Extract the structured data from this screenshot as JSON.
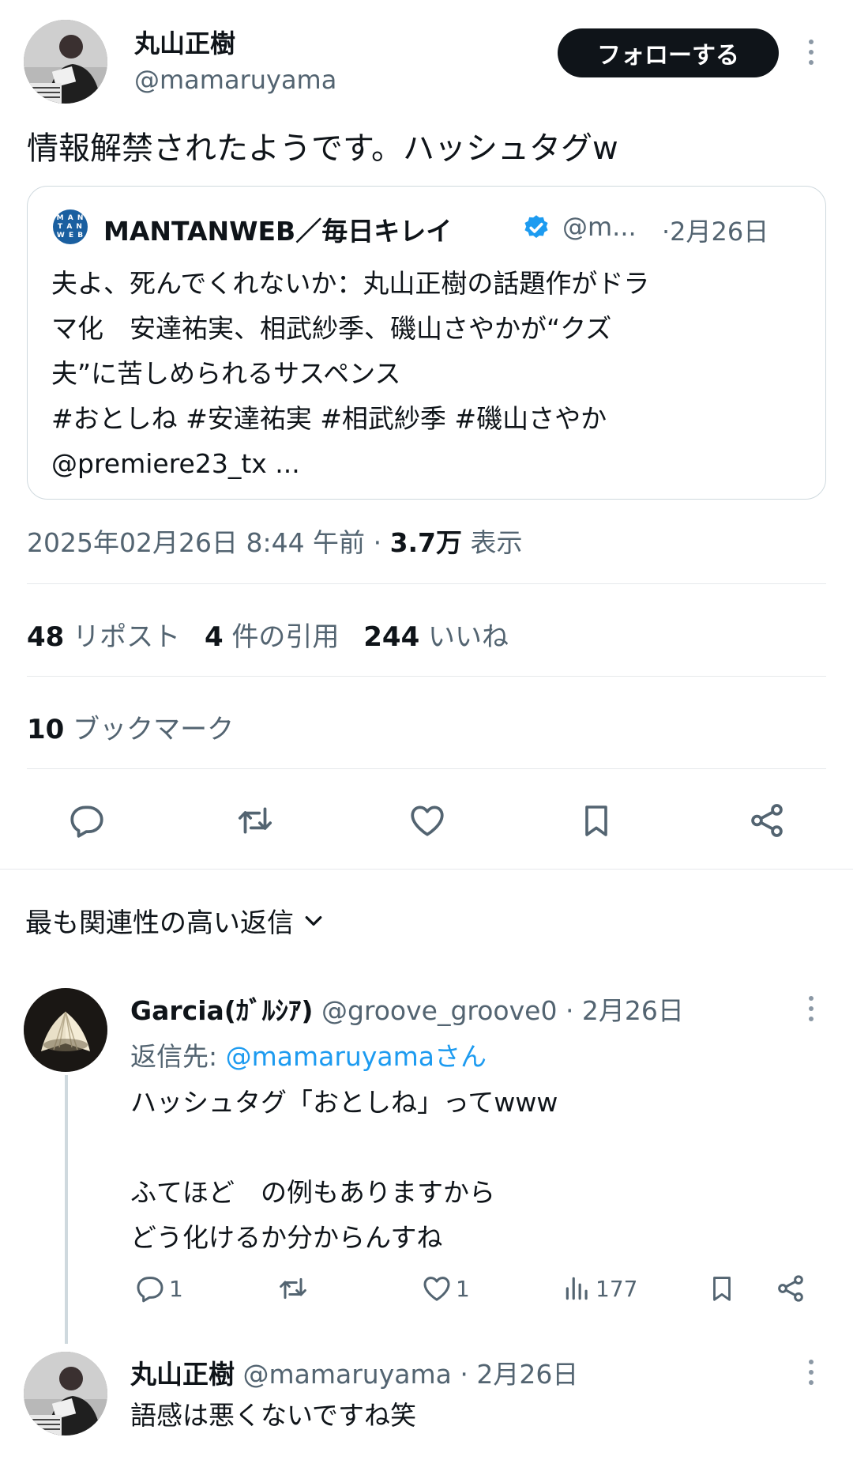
{
  "author": {
    "name": "丸山正樹",
    "handle": "@mamaruyama",
    "follow_label": "フォローする"
  },
  "tweet": {
    "text": "情報解禁されたようです。ハッシュタグw",
    "date": "2025年02月26日 8:44 午前",
    "sep": "·",
    "views_count": "3.7万",
    "views_label": "表示"
  },
  "quote": {
    "logo_text": "MANTANWEB",
    "name": "MANTANWEB／毎日キレイ",
    "handle": "@m...",
    "date": "·2月26日",
    "lines": [
      "夫よ、死んでくれないか：丸山正樹の話題作がドラ",
      "マ化　安達祐実、相武紗季、磯山さやかが“クズ",
      "夫”に苦しめられるサスペンス",
      "#おとしね #安達祐実 #相武紗季 #磯山さやか",
      "@premiere23_tx ..."
    ]
  },
  "stats": {
    "reposts_count": "48",
    "reposts_label": "リポスト",
    "quotes_count": "4",
    "quotes_label": "件の引用",
    "likes_count": "244",
    "likes_label": "いいね",
    "bookmarks_count": "10",
    "bookmarks_label": "ブックマーク"
  },
  "actions": [
    "reply-icon",
    "repost-icon",
    "like-icon",
    "bookmark-icon",
    "share-icon"
  ],
  "replies_header": {
    "label": "最も関連性の高い返信"
  },
  "replies": [
    {
      "name": "Garcia(ｶﾞﾙｼｱ)",
      "handle": "@groove_groove0",
      "date": "· 2月26日",
      "reply_to_prefix": "返信先: ",
      "reply_to_handle": "@mamaruyamaさん",
      "lines": [
        "ハッシュタグ「おとしね」ってwww",
        "",
        "ふてほど　の例もありますから",
        "どう化けるか分からんすね"
      ],
      "reply_count": "1",
      "like_count": "1",
      "view_count": "177"
    },
    {
      "name": "丸山正樹",
      "handle": "@mamaruyama",
      "date": "· 2月26日",
      "lines": [
        "語感は悪くないですね笑"
      ]
    }
  ],
  "colors": {
    "link": "#1d9bf0",
    "muted": "#536471",
    "text": "#0f1419",
    "verified": "#1d9bf0"
  }
}
